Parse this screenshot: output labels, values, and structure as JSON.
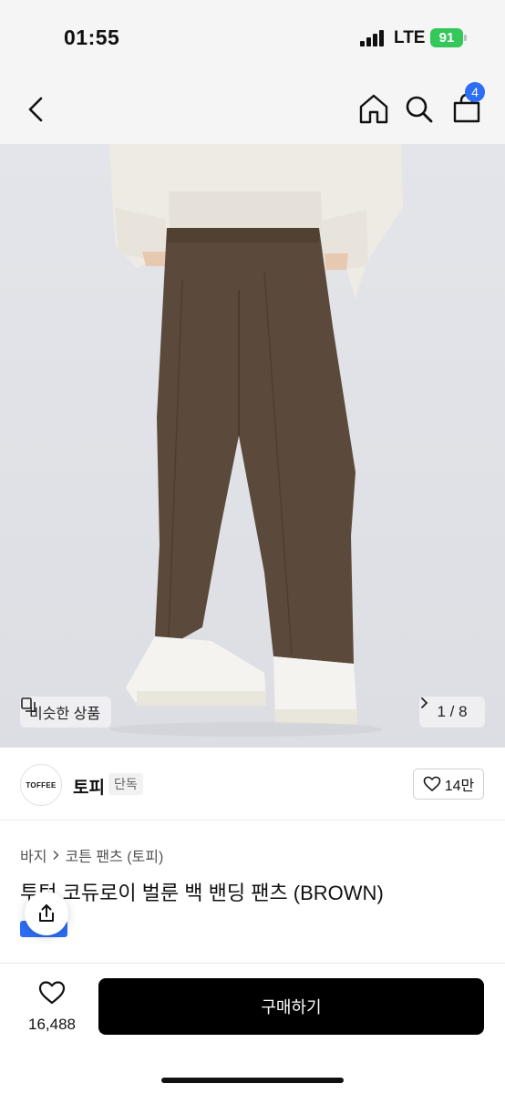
{
  "status": {
    "time": "01:55",
    "network": "LTE",
    "battery": "91"
  },
  "nav": {
    "back_icon": "chevron-left-icon",
    "home_icon": "home-icon",
    "search_icon": "search-icon",
    "cart_icon": "cart-icon",
    "cart_count": "4"
  },
  "gallery": {
    "similar_label": "비슷한 상품",
    "pager": "1 / 8"
  },
  "brand": {
    "logo_text": "TOFFEE",
    "name": "토피",
    "tag": "단독",
    "likes": "14만"
  },
  "product": {
    "breadcrumb": [
      "바지",
      "코튼 팬츠 (토피)"
    ],
    "title": "투턱 코듀로이 벌룬 백 밴딩 팬츠 (BROWN)"
  },
  "bottom": {
    "wish_count": "16,488",
    "buy_label": "구매하기"
  },
  "colors": {
    "accent": "#2c6ef5",
    "battery": "#34c759",
    "buy": "#000000"
  }
}
